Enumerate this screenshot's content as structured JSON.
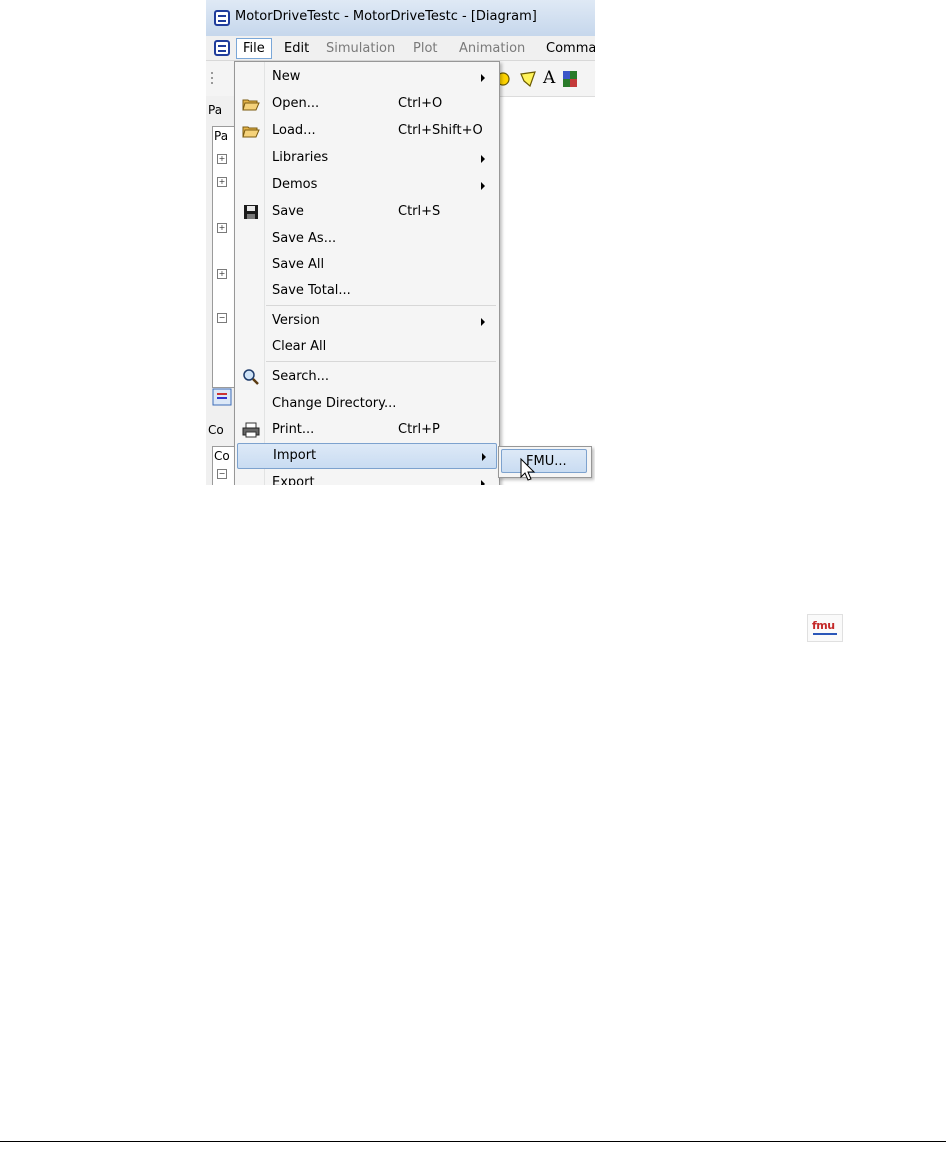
{
  "window": {
    "title": "MotorDriveTestc - MotorDriveTestc  - [Diagram]"
  },
  "menubar": {
    "items": [
      "File",
      "Edit",
      "Simulation",
      "Plot",
      "Animation",
      "Comma"
    ]
  },
  "toolbar": {
    "text_tool": "A"
  },
  "left_panel": {
    "tabs": [
      "Pa",
      "Pa",
      "Co",
      "Co"
    ]
  },
  "file_menu": {
    "items": [
      {
        "label": "New",
        "shortcut": "",
        "submenu": true,
        "icon": ""
      },
      {
        "label": "Open...",
        "shortcut": "Ctrl+O",
        "submenu": false,
        "icon": "open-folder-icon"
      },
      {
        "label": "Load...",
        "shortcut": "Ctrl+Shift+O",
        "submenu": false,
        "icon": "load-folder-icon"
      },
      {
        "label": "Libraries",
        "shortcut": "",
        "submenu": true,
        "icon": ""
      },
      {
        "label": "Demos",
        "shortcut": "",
        "submenu": true,
        "icon": ""
      },
      {
        "label": "Save",
        "shortcut": "Ctrl+S",
        "submenu": false,
        "icon": "floppy-disk-icon"
      },
      {
        "label": "Save As...",
        "shortcut": "",
        "submenu": false,
        "icon": ""
      },
      {
        "label": "Save All",
        "shortcut": "",
        "submenu": false,
        "icon": ""
      },
      {
        "label": "Save Total...",
        "shortcut": "",
        "submenu": false,
        "icon": ""
      },
      {
        "label": "Version",
        "shortcut": "",
        "submenu": true,
        "icon": ""
      },
      {
        "label": "Clear All",
        "shortcut": "",
        "submenu": false,
        "icon": ""
      },
      {
        "label": "Search...",
        "shortcut": "",
        "submenu": false,
        "icon": "magnifier-icon"
      },
      {
        "label": "Change Directory...",
        "shortcut": "",
        "submenu": false,
        "icon": ""
      },
      {
        "label": "Print...",
        "shortcut": "Ctrl+P",
        "submenu": false,
        "icon": "printer-icon"
      },
      {
        "label": "Import",
        "shortcut": "",
        "submenu": true,
        "icon": "",
        "highlighted": true
      },
      {
        "label": "Export",
        "shortcut": "",
        "submenu": true,
        "icon": ""
      }
    ]
  },
  "import_submenu": {
    "items": [
      {
        "label": "FMU...",
        "highlighted": true
      }
    ]
  },
  "fmu_logo": {
    "text": "fmu"
  },
  "colors": {
    "highlight": "#c9dcf2",
    "highlight_border": "#7da2ce",
    "menu_bg": "#f5f5f5",
    "fmu_red": "#c42828",
    "fmu_blue": "#2a56b8"
  }
}
